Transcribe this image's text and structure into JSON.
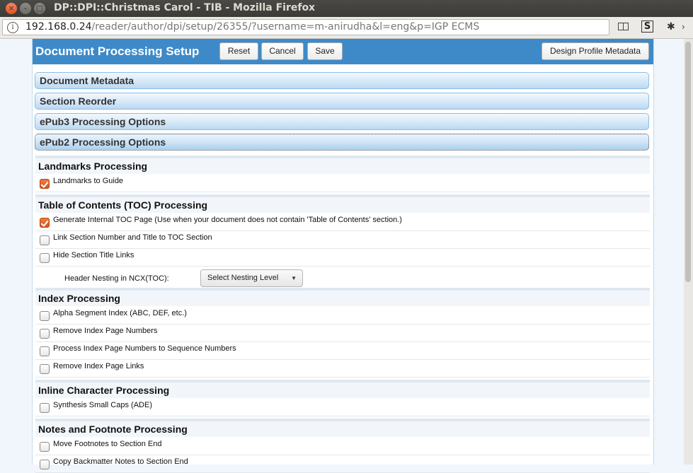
{
  "window": {
    "title": "DP::DPI::Christmas Carol - TIB - Mozilla Firefox",
    "close_glyph": "×",
    "min_glyph": "–",
    "max_glyph": "□"
  },
  "browser": {
    "url_host": "192.168.0.24",
    "url_path": "/reader/author/dpi/setup/26355/?username=m-anirudha&l=eng&p=IGP ECMS",
    "info_glyph": "i",
    "s_glyph": "S",
    "bug_glyph": "✱",
    "chevron_glyph": "›"
  },
  "header": {
    "title": "Document Processing Setup",
    "reset_label": "Reset",
    "cancel_label": "Cancel",
    "save_label": "Save",
    "design_label": "Design Profile Metadata"
  },
  "accordions": [
    {
      "label": "Document Metadata"
    },
    {
      "label": "Section Reorder"
    },
    {
      "label": "ePub3 Processing Options"
    },
    {
      "label": "ePub2 Processing Options"
    }
  ],
  "sections": {
    "landmarks": {
      "title": "Landmarks Processing",
      "options": [
        {
          "label": "Landmarks to Guide",
          "checked": true
        }
      ]
    },
    "toc": {
      "title": "Table of Contents (TOC) Processing",
      "options": [
        {
          "label": "Generate Internal TOC Page (Use when your document does not contain 'Table of Contents' section.)",
          "checked": true
        },
        {
          "label": "Link Section Number and Title to TOC Section",
          "checked": false
        },
        {
          "label": "Hide Section Title Links",
          "checked": false
        }
      ],
      "nesting_label": "Header Nesting in NCX(TOC):",
      "nesting_select": "Select Nesting Level",
      "caret_glyph": "▼"
    },
    "index": {
      "title": "Index Processing",
      "options": [
        {
          "label": "Alpha Segment Index (ABC, DEF, etc.)",
          "checked": false
        },
        {
          "label": "Remove Index Page Numbers",
          "checked": false
        },
        {
          "label": "Process Index Page Numbers to Sequence Numbers",
          "checked": false
        },
        {
          "label": "Remove Index Page Links",
          "checked": false
        }
      ]
    },
    "inline": {
      "title": "Inline Character Processing",
      "options": [
        {
          "label": "Synthesis Small Caps (ADE)",
          "checked": false
        }
      ]
    },
    "notes": {
      "title": "Notes and Footnote Processing",
      "options": [
        {
          "label": "Move Footnotes to Section End",
          "checked": false
        },
        {
          "label": "Copy Backmatter Notes to Section End",
          "checked": false
        }
      ]
    }
  }
}
